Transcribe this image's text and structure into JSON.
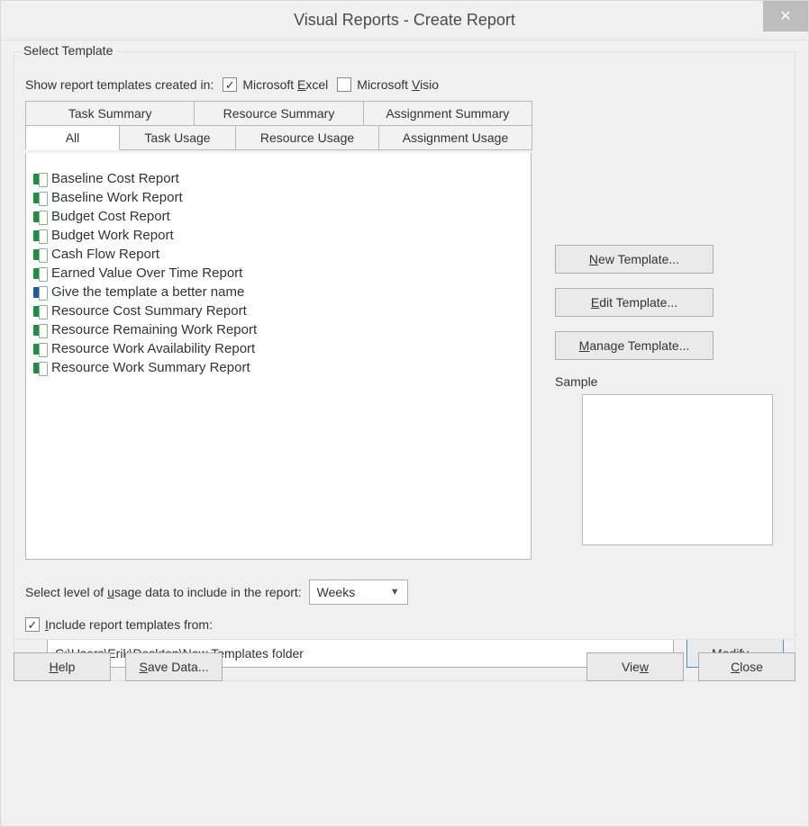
{
  "dialog": {
    "title": "Visual Reports - Create Report",
    "close_glyph": "✕"
  },
  "group": {
    "legend": "Select Template",
    "show_created_label": "Show report templates created in:",
    "chk_excel": {
      "checked": true,
      "prefix": "Microsoft ",
      "accel": "E",
      "suffix": "xcel"
    },
    "chk_visio": {
      "checked": false,
      "prefix": "Microsoft ",
      "accel": "V",
      "suffix": "isio"
    },
    "tabs_back": [
      "Task Summary",
      "Resource Summary",
      "Assignment Summary"
    ],
    "tabs_front": {
      "all": "All",
      "task_usage": "Task Usage",
      "resource_usage": "Resource Usage",
      "assignment_usage": "Assignment Usage"
    },
    "templates": [
      {
        "name": "Baseline Cost Report",
        "kind": "excel"
      },
      {
        "name": "Baseline Work Report",
        "kind": "excel"
      },
      {
        "name": "Budget Cost Report",
        "kind": "excel"
      },
      {
        "name": "Budget Work Report",
        "kind": "excel"
      },
      {
        "name": "Cash Flow Report",
        "kind": "excel"
      },
      {
        "name": "Earned Value Over Time Report",
        "kind": "excel"
      },
      {
        "name": "Give the template a better name",
        "kind": "visio"
      },
      {
        "name": "Resource Cost Summary Report",
        "kind": "excel"
      },
      {
        "name": "Resource Remaining Work Report",
        "kind": "excel"
      },
      {
        "name": "Resource Work Availability Report",
        "kind": "excel"
      },
      {
        "name": "Resource Work Summary Report",
        "kind": "excel"
      }
    ],
    "level_label_pre": "Select level of ",
    "level_label_accel": "u",
    "level_label_post": "sage data to include in the report:",
    "level_value": "Weeks",
    "include_checked": true,
    "include_accel": "I",
    "include_label_post": "nclude report templates from:",
    "path_value": "C:\\Users\\Erik\\Desktop\\New Templates folder"
  },
  "buttons": {
    "new_template": {
      "accel": "N",
      "rest": "ew Template..."
    },
    "edit_template": {
      "accel": "E",
      "rest": "dit Template..."
    },
    "manage_template": {
      "accel": "M",
      "rest": "anage Template..."
    },
    "sample_label": "Sample",
    "modify": {
      "pre": "M",
      "accel": "o",
      "rest": "dify..."
    },
    "help": {
      "accel": "H",
      "rest": "elp"
    },
    "save_data": {
      "accel": "S",
      "rest": "ave Data..."
    },
    "view": {
      "pre": "Vie",
      "accel": "w",
      "rest": ""
    },
    "close": {
      "accel": "C",
      "rest": "lose"
    }
  }
}
